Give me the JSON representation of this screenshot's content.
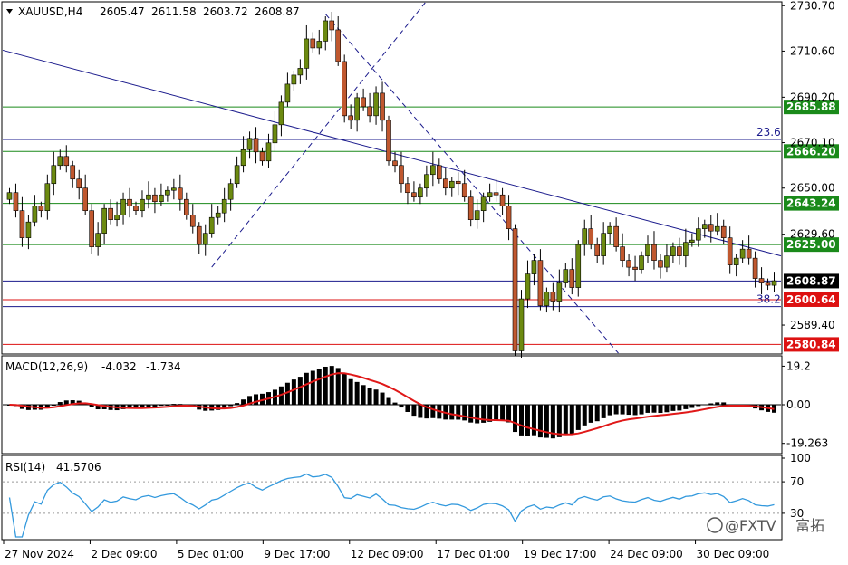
{
  "header": {
    "symbol": "XAUUSD,H4",
    "open": "2605.47",
    "high": "2611.58",
    "low": "2603.72",
    "close": "2608.87"
  },
  "macd": {
    "label": "MACD(12,26,9)",
    "value": "-4.032",
    "signal": "-1.734"
  },
  "rsi": {
    "label": "RSI(14)",
    "value": "41.5706"
  },
  "watermark": {
    "symbol": "@FXTV",
    "text": "富拓"
  },
  "colors": {
    "candle_up": "#6c8a10",
    "candle_down": "#c0582f",
    "green_level": "#1a8a1a",
    "red_level": "#dd1111",
    "navy": "#1a1a8c",
    "macd_signal": "#e01818",
    "rsi_line": "#3399dd"
  },
  "chart_data": {
    "type": "candlestick",
    "price_axis": {
      "ticks": [
        "2730.70",
        "2710.60",
        "2690.20",
        "2670.10",
        "2650.00",
        "2629.60",
        "2589.40"
      ],
      "range": [
        2577,
        2732
      ]
    },
    "time_axis": {
      "labels": [
        "27 Nov 2024",
        "2 Dec 09:00",
        "5 Dec 01:00",
        "9 Dec 17:00",
        "12 Dec 09:00",
        "17 Dec 01:00",
        "19 Dec 17:00",
        "24 Dec 09:00",
        "30 Dec 09:00"
      ]
    },
    "levels": [
      {
        "value": 2685.88,
        "label": "2685.88",
        "color": "green"
      },
      {
        "value": 2666.2,
        "label": "2666.20",
        "color": "green"
      },
      {
        "value": 2643.24,
        "label": "2643.24",
        "color": "green"
      },
      {
        "value": 2625.0,
        "label": "2625.00",
        "color": "green"
      },
      {
        "value": 2608.87,
        "label": "2608.87",
        "color": "current"
      },
      {
        "value": 2600.64,
        "label": "2600.64",
        "color": "red"
      },
      {
        "value": 2580.84,
        "label": "2580.84",
        "color": "red"
      }
    ],
    "fib_levels": [
      {
        "value": 2671.5,
        "label": "23.6"
      },
      {
        "value": 2597.6,
        "label": "38.2"
      }
    ],
    "closes": [
      2648,
      2640,
      2628,
      2635,
      2642,
      2640,
      2652,
      2660,
      2664,
      2660,
      2654,
      2650,
      2640,
      2624,
      2630,
      2641,
      2636,
      2638,
      2645,
      2642,
      2640,
      2645,
      2647,
      2644,
      2647,
      2649,
      2650,
      2645,
      2638,
      2633,
      2625,
      2630,
      2637,
      2639,
      2645,
      2652,
      2660,
      2667,
      2672,
      2666,
      2662,
      2670,
      2678,
      2688,
      2696,
      2700,
      2703,
      2716,
      2712,
      2715,
      2724,
      2720,
      2706,
      2682,
      2680,
      2690,
      2686,
      2682,
      2692,
      2680,
      2662,
      2660,
      2652,
      2648,
      2646,
      2650,
      2656,
      2660,
      2654,
      2650,
      2653,
      2652,
      2646,
      2636,
      2640,
      2646,
      2648,
      2647,
      2642,
      2632,
      2578,
      2601,
      2612,
      2618,
      2598,
      2604,
      2600,
      2608,
      2614,
      2606,
      2625,
      2632,
      2625,
      2620,
      2630,
      2633,
      2624,
      2618,
      2615,
      2614,
      2620,
      2625,
      2618,
      2615,
      2620,
      2624,
      2620,
      2626,
      2627,
      2632,
      2634,
      2631,
      2633,
      2628,
      2616,
      2619,
      2623,
      2619,
      2610,
      2608,
      2607,
      2609
    ],
    "macd_axis": {
      "ticks": [
        "19.2",
        "0.00",
        "-19.263"
      ],
      "range": [
        -23,
        23
      ]
    },
    "rsi_axis": {
      "ticks": [
        "100",
        "70",
        "30"
      ],
      "range": [
        0,
        100
      ]
    }
  }
}
